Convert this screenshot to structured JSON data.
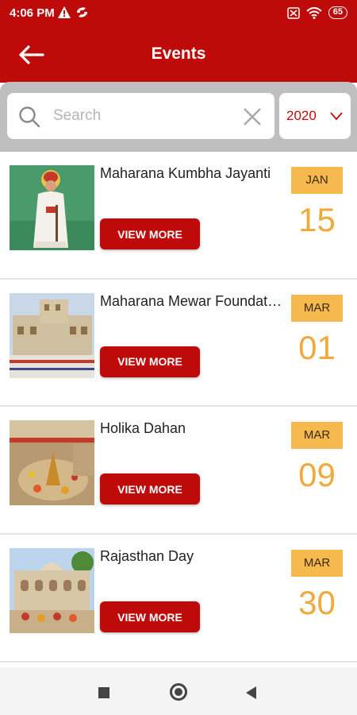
{
  "status_bar": {
    "time": "4:06 PM",
    "battery": "65"
  },
  "app_bar": {
    "title": "Events"
  },
  "filters": {
    "search_placeholder": "Search",
    "search_value": "",
    "year": "2020"
  },
  "events": [
    {
      "title": "Maharana Kumbha Jayanti",
      "button_label": "VIEW MORE",
      "month": "JAN",
      "day": "15"
    },
    {
      "title": "Maharana Mewar Foundation",
      "button_label": "VIEW MORE",
      "month": "MAR",
      "day": "01"
    },
    {
      "title": "Holika Dahan",
      "button_label": "VIEW MORE",
      "month": "MAR",
      "day": "09"
    },
    {
      "title": "Rajasthan Day",
      "button_label": "VIEW MORE",
      "month": "MAR",
      "day": "30"
    }
  ],
  "colors": {
    "primary": "#bf0a0a",
    "badge": "#f5b94d",
    "day_number": "#f0a93a",
    "strip": "#bfbfbf"
  }
}
